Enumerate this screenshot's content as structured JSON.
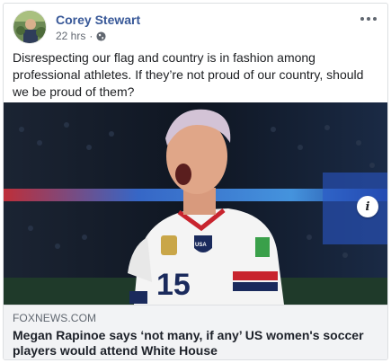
{
  "post": {
    "author": "Corey Stewart",
    "timestamp": "22 hrs",
    "separator": "·",
    "privacy_icon": "globe-icon",
    "more_icon": "more-options-icon",
    "text": "Disrespecting our flag and country is in fashion among professional athletes. If they’re not proud of our country, should we be proud of them?"
  },
  "image": {
    "jersey_number": "15",
    "jersey_badge": "USA"
  },
  "link": {
    "domain": "FOXNEWS.COM",
    "headline": "Megan Rapinoe says ‘not many, if any’ US women's soccer players would attend White House",
    "info_icon_label": "i"
  },
  "colors": {
    "author_link": "#385898",
    "link_box_bg": "#f2f3f5",
    "meta_text": "#616770"
  }
}
